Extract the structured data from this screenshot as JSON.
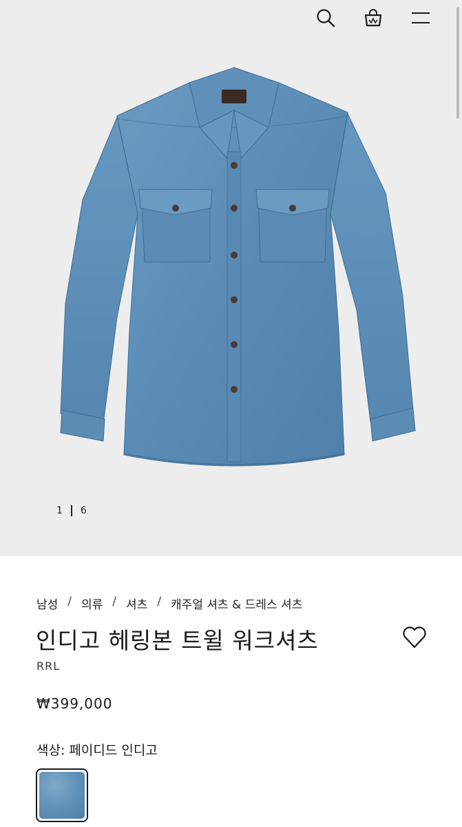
{
  "header": {
    "icons": [
      "search-icon",
      "shopping-bag-icon",
      "hamburger-menu-icon"
    ]
  },
  "gallery": {
    "current": "1",
    "total": "6"
  },
  "breadcrumb": [
    {
      "label": "남성"
    },
    {
      "label": "의류"
    },
    {
      "label": "셔츠"
    },
    {
      "label": "캐주얼 셔츠 & 드레스 셔츠"
    }
  ],
  "breadcrumb_separator": "/",
  "product": {
    "title": "인디고 헤링본 트윌 워크셔츠",
    "brand": "RRL",
    "price": "₩399,000",
    "color_label": "색상:",
    "color_value": "페이디드 인디고"
  },
  "colors": {
    "hero_bg": "#eeeded",
    "denim": "#5e8fb8"
  }
}
